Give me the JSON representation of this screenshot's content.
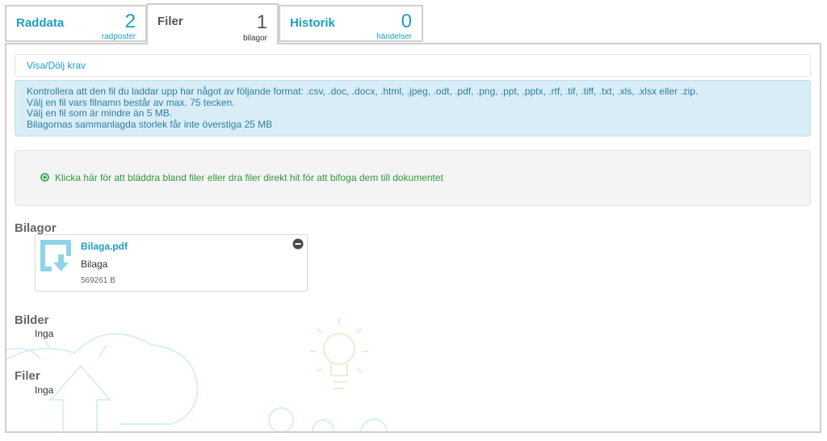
{
  "tabs": [
    {
      "label": "Raddata",
      "count": "2",
      "sub": "radposter"
    },
    {
      "label": "Filer",
      "count": "1",
      "sub": "bilagor"
    },
    {
      "label": "Historik",
      "count": "0",
      "sub": "händelser"
    }
  ],
  "toggle_label": "Visa/Dölj krav",
  "requirements": [
    "Kontrollera att den fil du laddar upp har något av följande format: .csv, .doc, .docx, .html, .jpeg, .odt, .pdf, .png, .ppt, .pptx, .rtf, .tif, .tiff, .txt, .xls, .xlsx eller .zip.",
    "Välj en fil vars filnamn består av max. 75 tecken.",
    "Välj en fil som är mindre än 5 MB.",
    "Bilagornas sammanlagda storlek får inte överstiga 25 MB"
  ],
  "dropzone_text": "Klicka här för att bläddra bland filer eller dra filer direkt hit för att bifoga dem till dokumentet",
  "sections": {
    "attachments": {
      "title": "Bilagor",
      "file": {
        "name": "Bilaga.pdf",
        "description": "Bilaga",
        "size": "569261 B"
      }
    },
    "images": {
      "title": "Bilder",
      "empty": "Inga"
    },
    "files": {
      "title": "Filer",
      "empty": "Inga"
    }
  },
  "colors": {
    "accent": "#1c9fc2",
    "success": "#2d9a3b",
    "info_bg": "#d8edf6"
  },
  "icons": [
    "file-download-icon",
    "remove-icon",
    "plus-circle-icon"
  ]
}
